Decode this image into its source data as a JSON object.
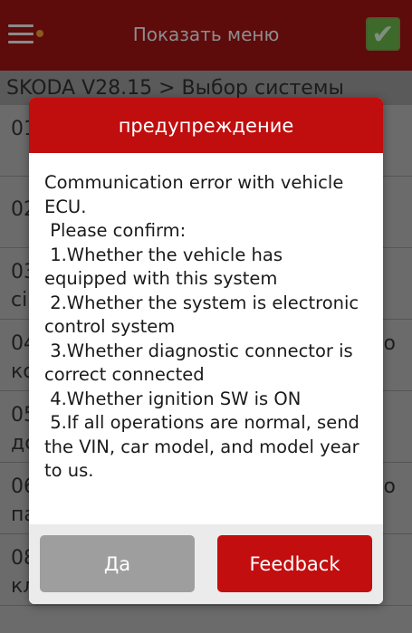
{
  "topbar": {
    "title": "Показать меню",
    "menu_icon": "hamburger-menu-icon",
    "confirm_icon": "checkmark-icon"
  },
  "breadcrumb": "SKODA V28.15 > Выбор системы",
  "list": {
    "rows": [
      {
        "line1": "01",
        "line2": ""
      },
      {
        "line1": "02",
        "line2": ""
      },
      {
        "line1": "03",
        "line2": "сі"
      },
      {
        "line1": "04",
        "line2": "кс",
        "tail": "о"
      },
      {
        "line1": "05",
        "line2": "дс"
      },
      {
        "line1": "06",
        "line2": "па",
        "tail": "о"
      },
      {
        "line1": "08",
        "line2": "кл"
      }
    ]
  },
  "dialog": {
    "title": "предупреждение",
    "message_lines": [
      "Communication error with vehicle ECU.",
      " Please confirm:",
      " 1.Whether the vehicle has equipped with this system",
      " 2.Whether the system is electronic control system",
      " 3.Whether diagnostic connector is correct connected",
      " 4.Whether ignition SW is ON",
      " 5.If all operations are normal, send the VIN, car model, and model year to us."
    ],
    "buttons": {
      "yes_label": "Да",
      "feedback_label": "Feedback"
    }
  },
  "colors": {
    "dialog_header": "#c00d0e",
    "feedback_button": "#c30e0f",
    "yes_button": "#9e9e9e"
  }
}
